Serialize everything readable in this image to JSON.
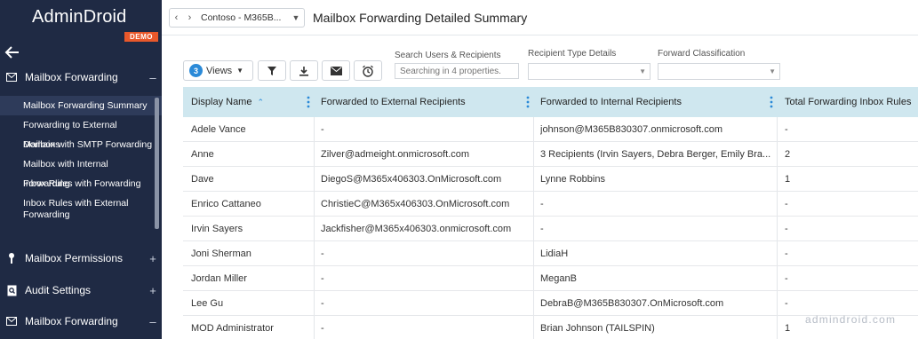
{
  "brand": {
    "name": "AdminDroid",
    "badge": "DEMO"
  },
  "sidebar": {
    "sections": [
      {
        "label": "Mailbox Forwarding",
        "toggle": "–",
        "icon": "envelope-icon"
      },
      {
        "label": "Mailbox Permissions",
        "toggle": "+",
        "icon": "key-icon"
      },
      {
        "label": "Audit Settings",
        "toggle": "+",
        "icon": "audit-document-icon"
      },
      {
        "label": "Mailbox Forwarding",
        "toggle": "–",
        "icon": "envelope-icon"
      }
    ],
    "items": [
      {
        "label": "Mailbox Forwarding Summary",
        "active": true
      },
      {
        "label": "Forwarding to External Domains"
      },
      {
        "label": "Mailbox with SMTP Forwarding"
      },
      {
        "label": "Mailbox with Internal Forwarding"
      },
      {
        "label": "Inbox Rules with Forwarding"
      },
      {
        "label": "Inbox Rules with External Forwarding"
      }
    ]
  },
  "header": {
    "tenant": "Contoso - M365B...",
    "title": "Mailbox Forwarding Detailed Summary"
  },
  "toolbar": {
    "views_count": "3",
    "views_label": "Views",
    "search_label": "Search Users & Recipients",
    "search_placeholder": "Searching in 4 properties.",
    "recipient_type_label": "Recipient Type Details",
    "forward_class_label": "Forward Classification"
  },
  "table": {
    "columns": [
      "Display Name",
      "Forwarded to External Recipients",
      "Forwarded to Internal Recipients",
      "Total Forwarding Inbox Rules"
    ],
    "rows": [
      [
        "Adele Vance",
        "-",
        "johnson@M365B830307.onmicrosoft.com",
        "-"
      ],
      [
        "Anne",
        "Zilver@admeight.onmicrosoft.com",
        "3 Recipients (Irvin Sayers, Debra Berger, Emily Bra...",
        "2"
      ],
      [
        "Dave",
        "DiegoS@M365x406303.OnMicrosoft.com",
        "Lynne Robbins",
        "1"
      ],
      [
        "Enrico Cattaneo",
        "ChristieC@M365x406303.OnMicrosoft.com",
        "-",
        "-"
      ],
      [
        "Irvin Sayers",
        "Jackfisher@M365x406303.onmicrosoft.com",
        "-",
        "-"
      ],
      [
        "Joni Sherman",
        "-",
        "LidiaH",
        "-"
      ],
      [
        "Jordan Miller",
        "-",
        "MeganB",
        "-"
      ],
      [
        "Lee Gu",
        "-",
        "DebraB@M365B830307.OnMicrosoft.com",
        "-"
      ],
      [
        "MOD Administrator",
        "-",
        "Brian Johnson (TAILSPIN)",
        "1"
      ]
    ]
  },
  "watermark": "admindroid.com",
  "colors": {
    "sidebar": "#1f2a44",
    "header_row": "#cfe7ef",
    "accent": "#2b8ad8",
    "badge": "#e8582b"
  }
}
